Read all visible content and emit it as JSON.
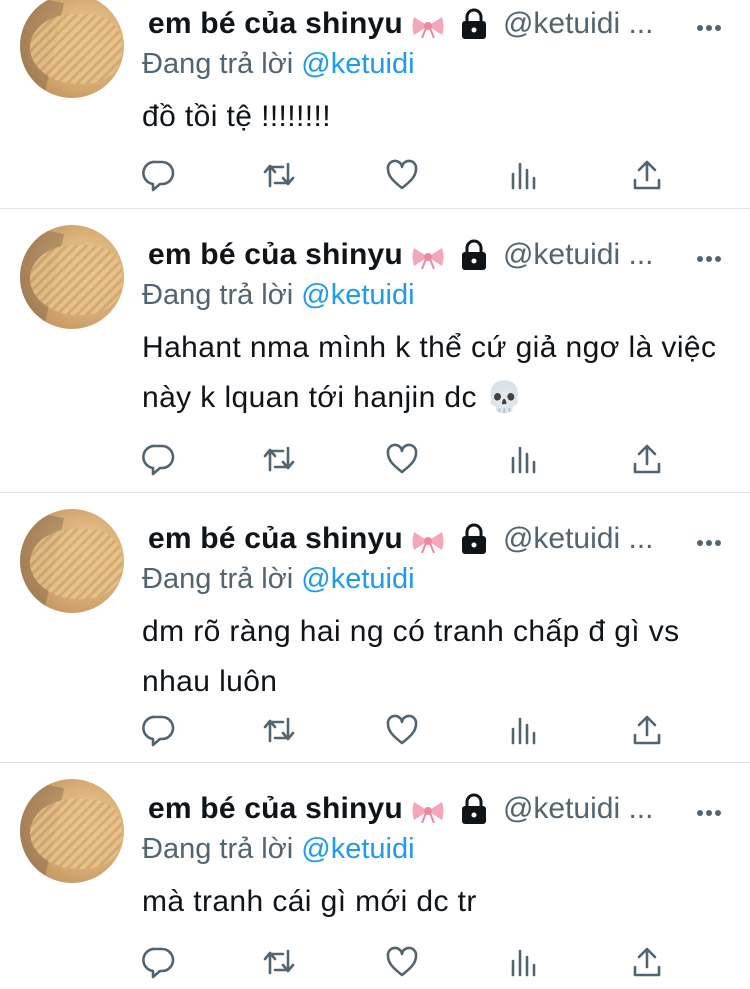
{
  "tweets": [
    {
      "name": "em bé của shinyu",
      "handle": "@ketuidi ...",
      "replying_label": "Đang trả lời",
      "replying_to": "@ketuidi",
      "content": "đồ tồi tệ !!!!!!!!"
    },
    {
      "name": "em bé của shinyu",
      "handle": "@ketuidi ...",
      "replying_label": "Đang trả lời",
      "replying_to": "@ketuidi",
      "content": "Hahant nma mình k thể cứ giả ngơ là việc này k lquan tới hanjin dc 💀"
    },
    {
      "name": "em bé của shinyu",
      "handle": "@ketuidi ...",
      "replying_label": "Đang trả lời",
      "replying_to": "@ketuidi",
      "content": "dm rõ ràng hai ng có tranh chấp đ gì vs nhau luôn"
    },
    {
      "name": "em bé của shinyu",
      "handle": "@ketuidi ...",
      "replying_label": "Đang trả lời",
      "replying_to": "@ketuidi",
      "content": "mà tranh cái gì mới dc tr"
    }
  ],
  "icons": {
    "name_emoji": "ribbon-icon",
    "protected": "lock-icon",
    "more": "more-icon",
    "reply": "reply-icon",
    "retweet": "retweet-icon",
    "like": "heart-icon",
    "views": "views-icon",
    "share": "share-icon"
  },
  "colors": {
    "text": "#0f1419",
    "secondary": "#536471",
    "link": "#1d9bf0",
    "divider": "#dfe3e7",
    "ribbon": "#f4a7b9"
  }
}
